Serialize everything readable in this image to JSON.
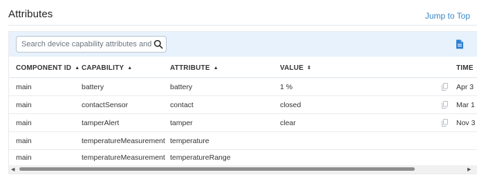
{
  "section": {
    "title": "Attributes",
    "jump_link": "Jump to Top"
  },
  "search": {
    "placeholder": "Search device capability attributes and values"
  },
  "columns": [
    {
      "label": "COMPONENT ID",
      "sort": "▲"
    },
    {
      "label": "CAPABILITY",
      "sort": "▲"
    },
    {
      "label": "ATTRIBUTE",
      "sort": "▲"
    },
    {
      "label": "VALUE",
      "sort": "⇕"
    },
    {
      "label": "TIME"
    }
  ],
  "rows": [
    {
      "component": "main",
      "capability": "battery",
      "attribute": "battery",
      "value": "1 %",
      "time": "Apr 3"
    },
    {
      "component": "main",
      "capability": "contactSensor",
      "attribute": "contact",
      "value": "closed",
      "time": "Mar 1"
    },
    {
      "component": "main",
      "capability": "tamperAlert",
      "attribute": "tamper",
      "value": "clear",
      "time": "Nov 3"
    },
    {
      "component": "main",
      "capability": "temperatureMeasurement",
      "attribute": "temperature",
      "value": "",
      "time": ""
    },
    {
      "component": "main",
      "capability": "temperatureMeasurement",
      "attribute": "temperatureRange",
      "value": "",
      "time": ""
    }
  ],
  "icons": {
    "search": "search-icon",
    "export": "export-file-icon",
    "copy": "copy-icon"
  },
  "colors": {
    "link": "#3a87c7",
    "toolbar_bg": "#e8f2fc"
  }
}
